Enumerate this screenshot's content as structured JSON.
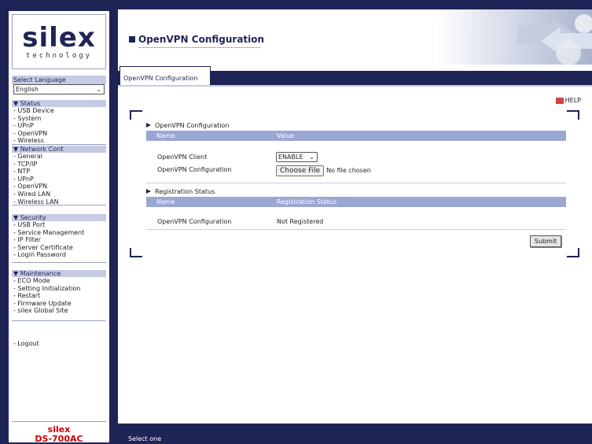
{
  "brand": {
    "logo_word": "silex",
    "logo_sub": "technology"
  },
  "sidebar": {
    "language_label": "Select Language",
    "language_value": "English",
    "groups": [
      {
        "header": "▼ Status",
        "items": [
          "- USB Device",
          "- System",
          "- UPnP",
          "- OpenVPN",
          "- Wireless"
        ]
      },
      {
        "header": "▼ Network Conf.",
        "items": [
          "- General",
          "- TCP/IP",
          "- NTP",
          "- UPnP",
          "- OpenVPN",
          "- Wired LAN",
          "- Wireless LAN"
        ]
      },
      {
        "header": "▼ Security",
        "items": [
          "- USB Port",
          "- Service Management",
          "- IP Filter",
          "- Server Certificate",
          "- Login Password"
        ]
      },
      {
        "header": "▼ Maintenance",
        "items": [
          "- ECO Mode",
          "- Setting Initialization",
          "- Restart",
          "- Firmware Update",
          "- silex Global Site"
        ]
      }
    ],
    "logout": "- Logout",
    "model_line1": "silex",
    "model_line2": "DS-700AC"
  },
  "header": {
    "title": "OpenVPN Configuration"
  },
  "tabs": [
    {
      "label": "OpenVPN Configuration",
      "active": true
    }
  ],
  "help_label": "HELP",
  "sections": {
    "config": {
      "title": "OpenVPN Configuration",
      "col_name": "Name",
      "col_value": "Value",
      "client_label": "OpenVPN Client",
      "client_value": "ENABLE",
      "config_label": "OpenVPN Configuration",
      "choose_file_label": "Choose File",
      "no_file_text": "No file chosen"
    },
    "registration": {
      "title": "Registration Status",
      "col_name": "Name",
      "col_value": "Registration Status",
      "row_label": "OpenVPN Configuration",
      "row_value": "Not Registered"
    }
  },
  "submit_label": "Submit",
  "footer_status": "Select one",
  "colors": {
    "navy": "#1f2456",
    "table_header": "#9aa7d4",
    "nav_header": "#c6cbe3",
    "model_red": "#cc0000"
  }
}
